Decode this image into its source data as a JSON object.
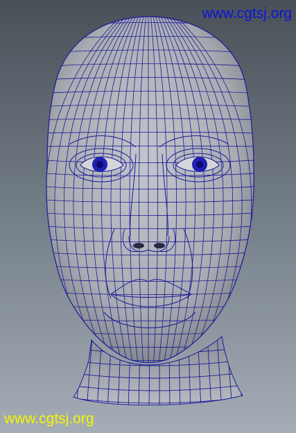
{
  "viewport": {
    "background_top": "#4a5058",
    "background_bottom": "#a4adb6"
  },
  "model": {
    "icon": "wireframe-head-model",
    "surface_color": "#a9acb2",
    "wire_color": "#1a1a96"
  },
  "watermarks": {
    "top_text": "www.cgtsj.org",
    "top_color": "#0a14d8",
    "bottom_text": "www.cgtsj.org",
    "bottom_color": "#f6f600"
  }
}
